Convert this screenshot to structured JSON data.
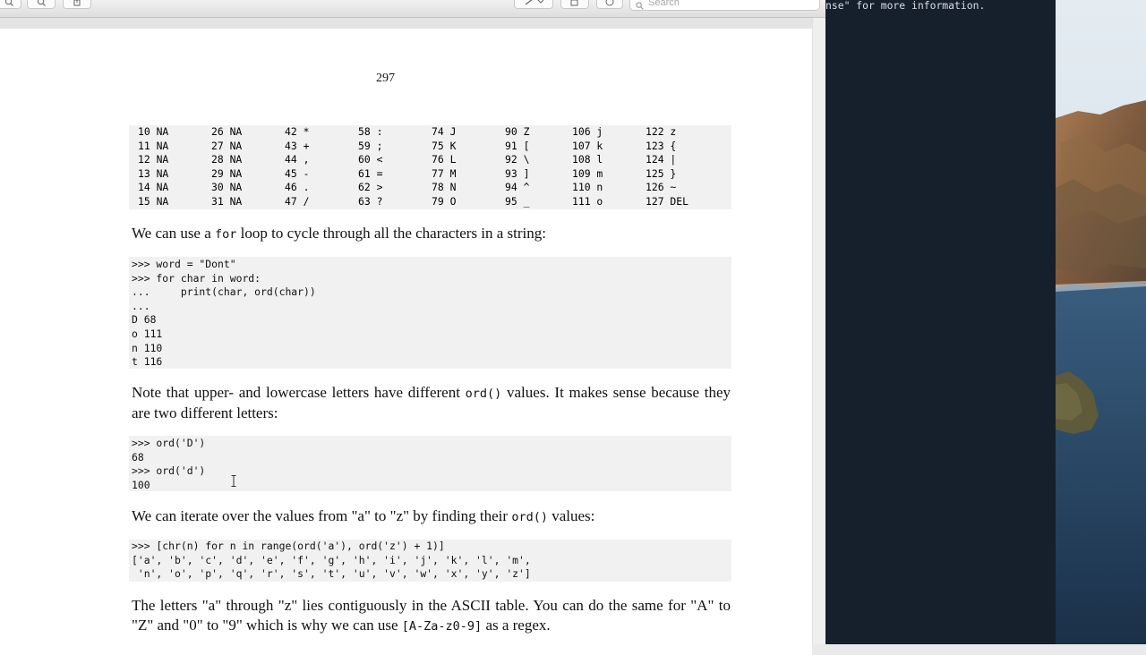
{
  "toolbar": {
    "search_placeholder": "Search"
  },
  "page": {
    "number": "297",
    "ascii_table": [
      [
        "10 NA",
        "26 NA",
        "42 *",
        "58 :",
        "74 J",
        "90 Z",
        "106 j",
        "122 z"
      ],
      [
        "11 NA",
        "27 NA",
        "43 +",
        "59 ;",
        "75 K",
        "91 [",
        "107 k",
        "123 {"
      ],
      [
        "12 NA",
        "28 NA",
        "44 ,",
        "60 <",
        "76 L",
        "92 \\",
        "108 l",
        "124 |"
      ],
      [
        "13 NA",
        "29 NA",
        "45 -",
        "61 =",
        "77 M",
        "93 ]",
        "109 m",
        "125 }"
      ],
      [
        "14 NA",
        "30 NA",
        "46 .",
        "62 >",
        "78 N",
        "94 ^",
        "110 n",
        "126 ~"
      ],
      [
        "15 NA",
        "31 NA",
        "47 /",
        "63 ?",
        "79 O",
        "95 _",
        "111 o",
        "127 DEL"
      ]
    ],
    "para1": {
      "before": "We can use a ",
      "code": "for",
      "after": " loop to cycle through all the characters in a string:"
    },
    "code1": ">>> word = \"Dont\"\n>>> for char in word:\n...     print(char, ord(char))\n...\nD 68\no 111\nn 110\nt 116",
    "para2": {
      "before": "Note that upper- and lowercase letters have different ",
      "code": "ord()",
      "after": " values. It makes sense because they are two different letters:"
    },
    "code2": ">>> ord('D')\n68\n>>> ord('d')\n100",
    "para3": {
      "before": "We can iterate over the values from \"a\" to \"z\" by finding their ",
      "code": "ord()",
      "after": " values:"
    },
    "code3": ">>> [chr(n) for n in range(ord('a'), ord('z') + 1)]\n['a', 'b', 'c', 'd', 'e', 'f', 'g', 'h', 'i', 'j', 'k', 'l', 'm',\n 'n', 'o', 'p', 'q', 'r', 's', 't', 'u', 'v', 'w', 'x', 'y', 'z']",
    "para4": {
      "before": "The letters \"a\" through \"z\" lies contiguously in the ASCII table. You can do the same for \"A\" to \"Z\" and \"0\" to \"9\" which is why we can use ",
      "code": "[A-Za-z0-9]",
      "after": " as a regex."
    }
  },
  "terminal": {
    "visible_line": "nse\" for more information."
  },
  "colors": {
    "terminal_bg": "#16202c",
    "code_bg": "#f1f1f1",
    "page_bg": "#ffffff"
  }
}
